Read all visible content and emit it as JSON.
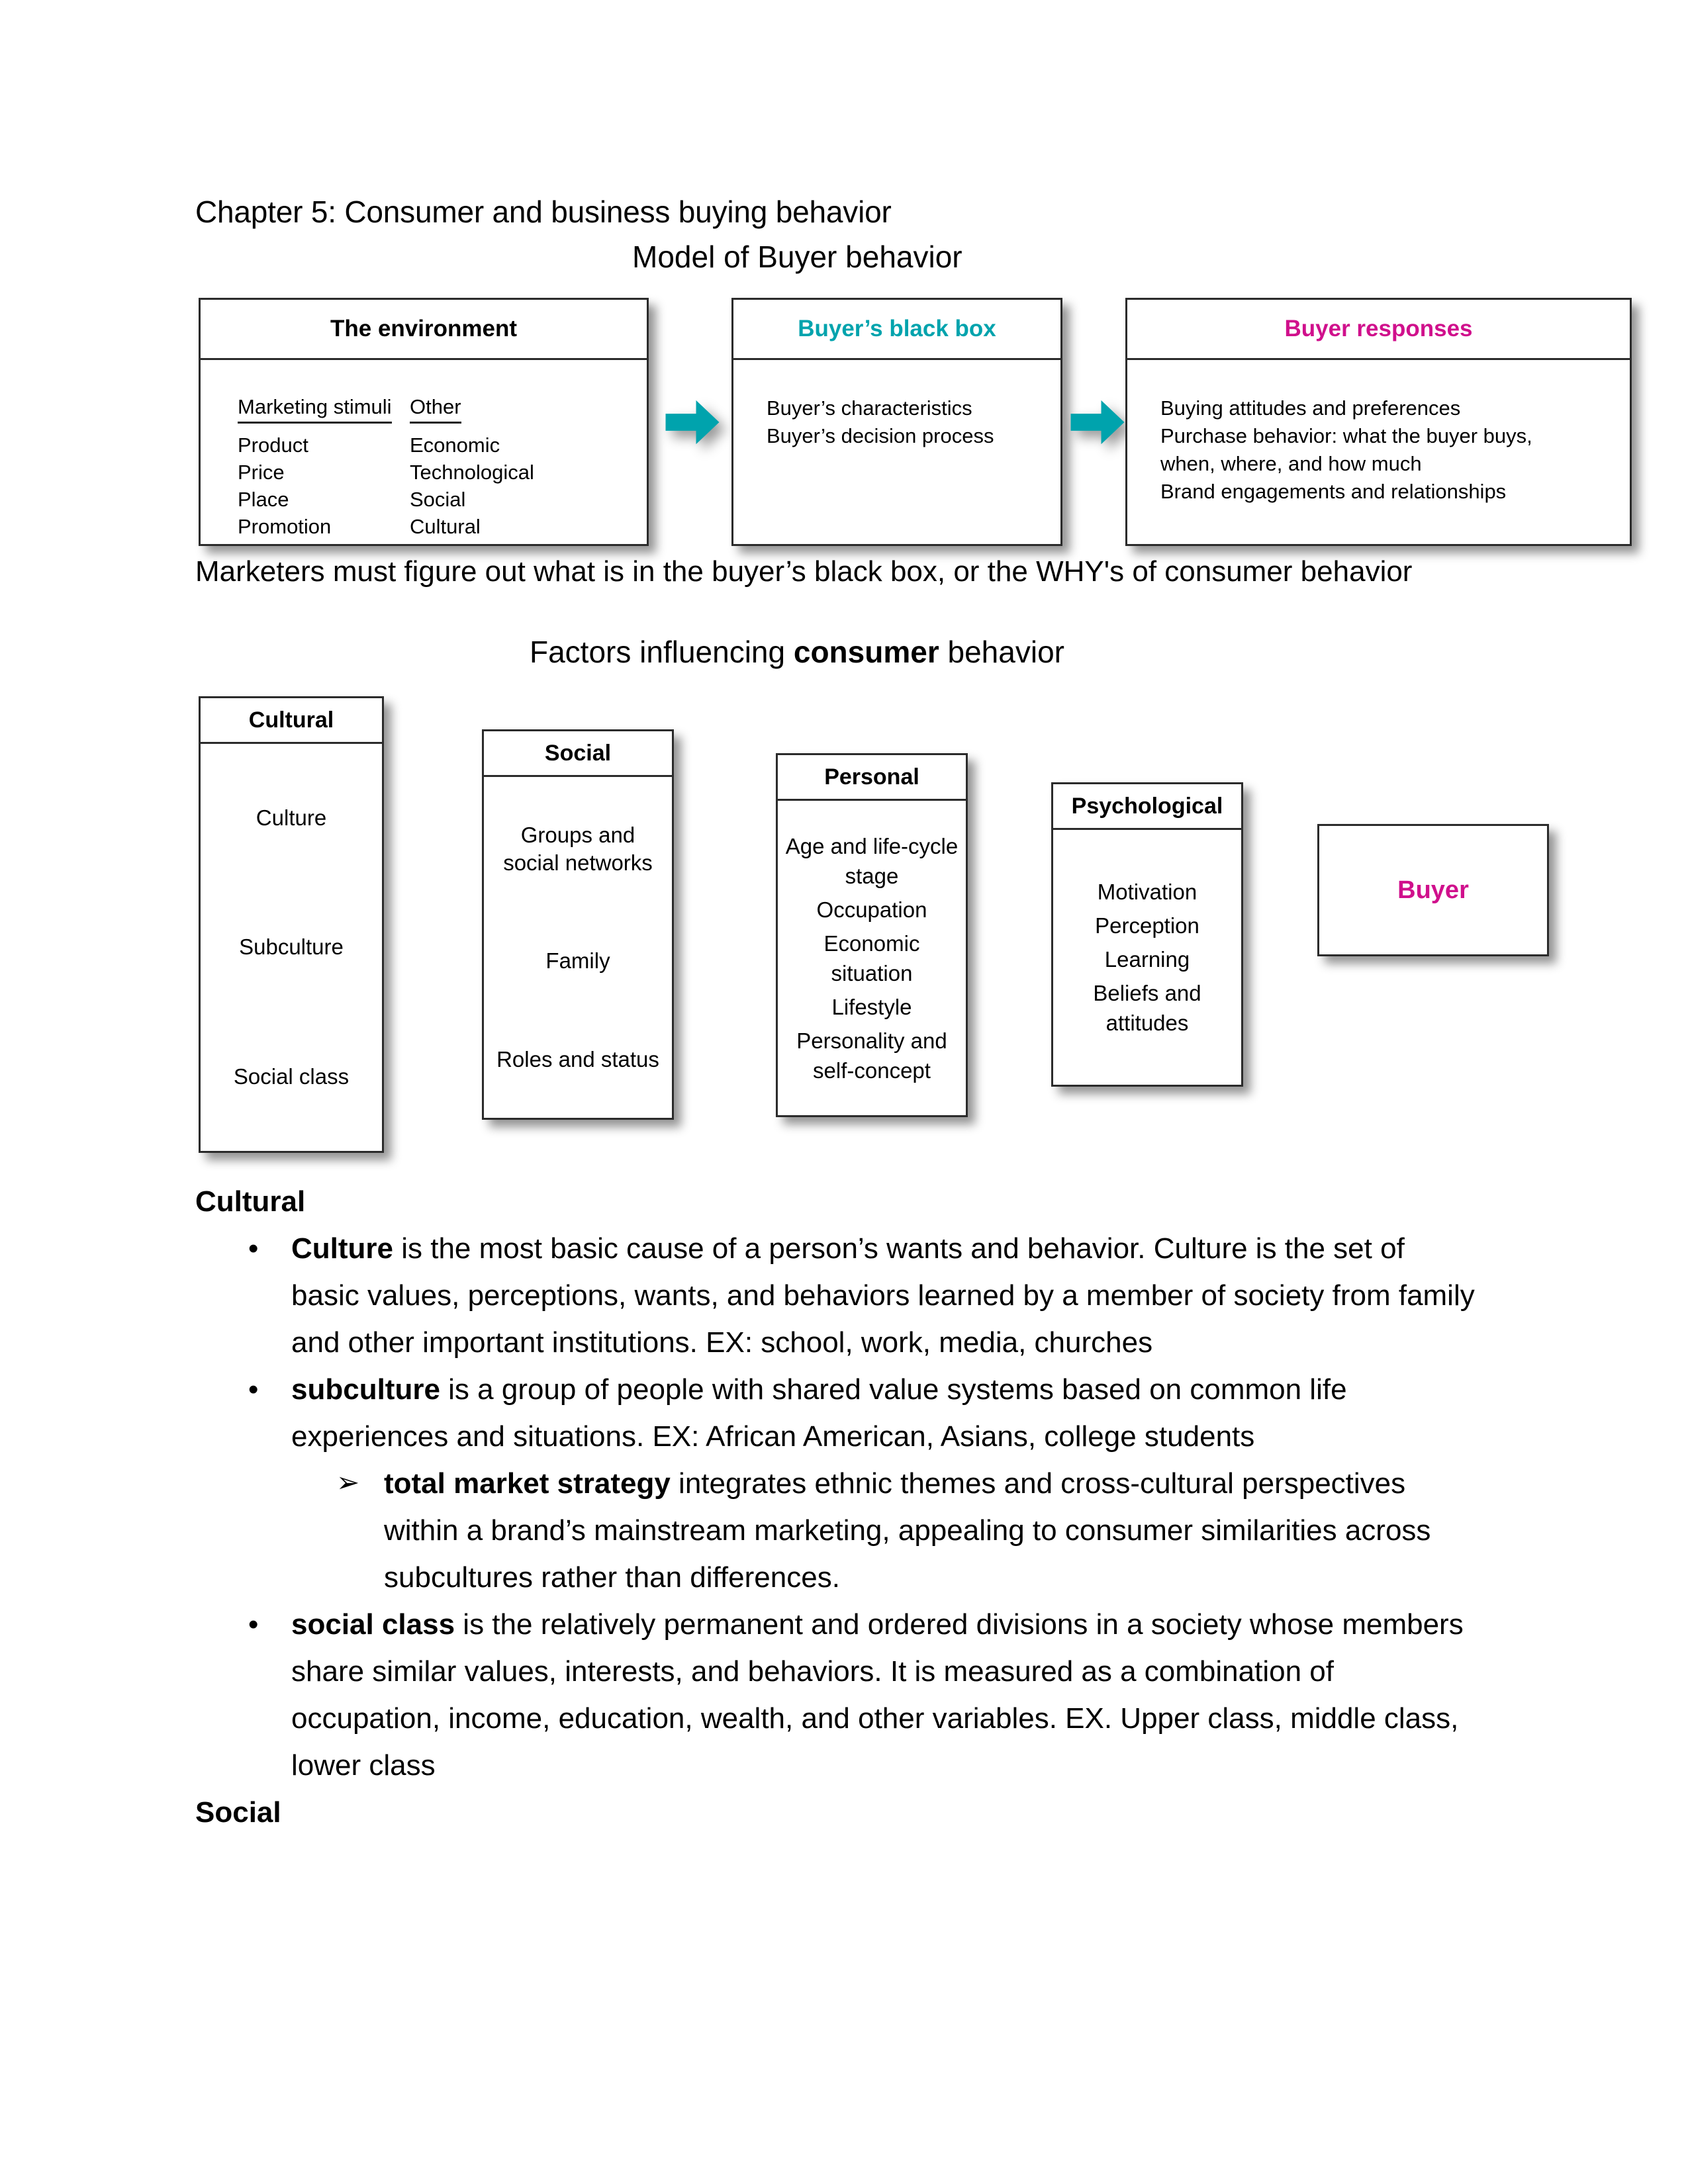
{
  "document": {
    "title": "Chapter 5: Consumer and business buying behavior",
    "model_heading": "Model of Buyer behavior",
    "caption": "Marketers must figure out what is in the buyer’s black box, or the WHY's of consumer behavior",
    "factors_heading_pre": "Factors influencing ",
    "factors_heading_bold": "consumer",
    "factors_heading_post": " behavior"
  },
  "colors": {
    "teal": "#00A3AD",
    "magenta": "#D0108C",
    "box_border": "#2b2b2b"
  },
  "buyer_model": {
    "environment": {
      "title": "The environment",
      "columns": [
        {
          "heading": "Marketing stimuli",
          "items": [
            "Product",
            "Price",
            "Place",
            "Promotion"
          ]
        },
        {
          "heading": "Other",
          "items": [
            "Economic",
            "Technological",
            "Social",
            "Cultural"
          ]
        }
      ]
    },
    "black_box": {
      "title": "Buyer’s black box",
      "items": [
        "Buyer’s characteristics",
        "Buyer’s decision process"
      ]
    },
    "responses": {
      "title": "Buyer responses",
      "items": [
        "Buying attitudes and preferences",
        "Purchase behavior: what the buyer buys,",
        "when, where, and how much",
        "Brand engagements and relationships"
      ]
    },
    "arrows": [
      "arrow-right-icon",
      "arrow-right-icon"
    ]
  },
  "factors_model": {
    "cultural": {
      "title": "Cultural",
      "items": [
        "Culture",
        "Subculture",
        "Social class"
      ]
    },
    "social": {
      "title": "Social",
      "items": [
        "Groups and social networks",
        "Family",
        "Roles and status"
      ]
    },
    "personal": {
      "title": "Personal",
      "items": [
        "Age and life-cycle stage",
        "Occupation",
        "Economic situation",
        "Lifestyle",
        "Personality and self-concept"
      ]
    },
    "psychological": {
      "title": "Psychological",
      "items": [
        "Motivation",
        "Perception",
        "Learning",
        "Beliefs and attitudes"
      ]
    },
    "buyer": {
      "label": "Buyer"
    }
  },
  "notes": {
    "cultural_heading": "Cultural",
    "social_heading": "Social",
    "bullet_marker": "•",
    "subbullet_marker": "➢",
    "bullets": [
      {
        "term": "Culture",
        "text": " is the most basic cause of a person’s wants and behavior. Culture is the set of basic values, perceptions, wants, and behaviors learned by a member of society from family and other important institutions. EX: school, work, media, churches"
      },
      {
        "term": "subculture",
        "text": " is a group of people with shared value systems based on common life experiences and situations. EX: African American, Asians, college students",
        "sub": [
          {
            "term": "total market strategy",
            "text": " integrates ethnic themes and cross-cultural perspectives within a brand’s mainstream marketing, appealing to consumer similarities across subcultures rather than differences."
          }
        ]
      },
      {
        "term": "social class",
        "text": " is the relatively permanent and ordered divisions in a society whose members share similar values, interests, and behaviors. It is measured as a combination of occupation, income, education, wealth, and other variables. EX. Upper class, middle class, lower class"
      }
    ]
  }
}
